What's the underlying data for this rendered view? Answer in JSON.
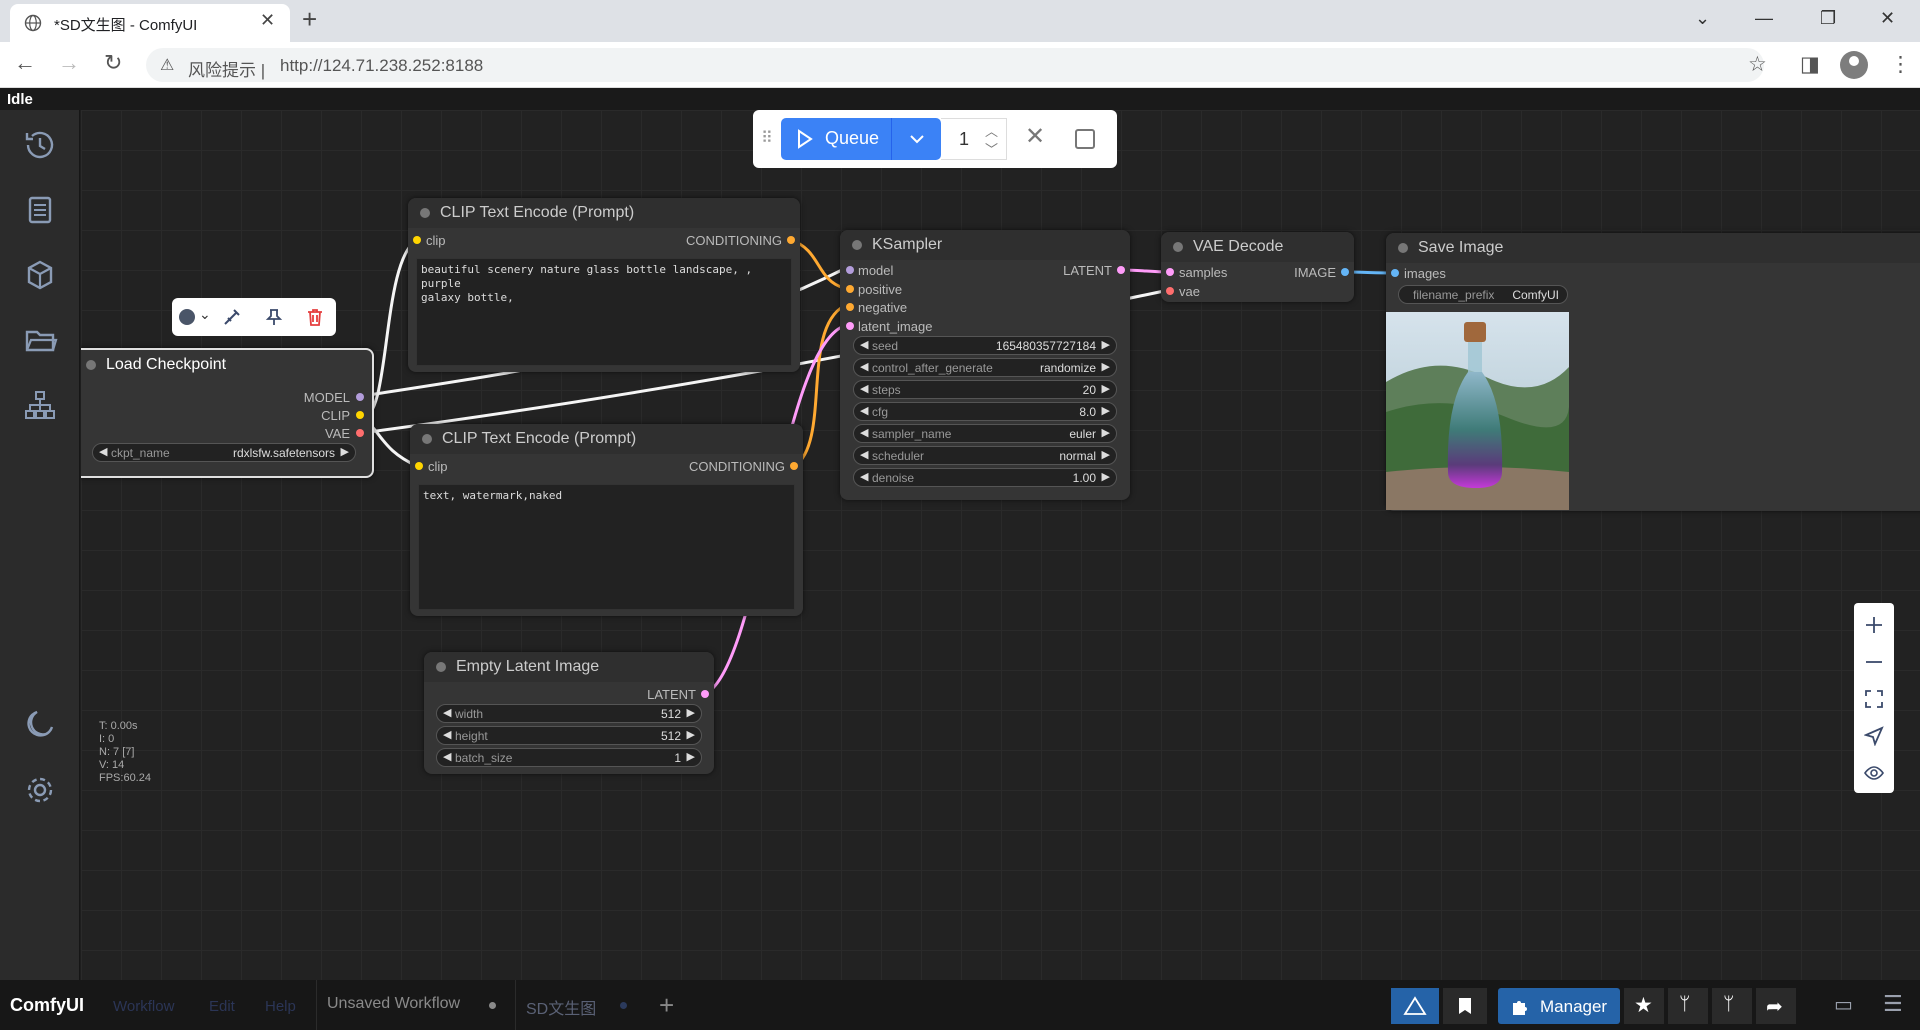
{
  "browser": {
    "tab_title": "*SD文生图 - ComfyUI",
    "address_warning": "风险提示 |",
    "url": "http://124.71.238.252:8188"
  },
  "app": {
    "status": "Idle",
    "brand": "ComfyUI",
    "menus": [
      "Workflow",
      "Edit",
      "Help"
    ],
    "workflow_tabs": [
      "Unsaved Workflow",
      "SD文生图"
    ],
    "manager_label": "Manager"
  },
  "queue": {
    "label": "Queue",
    "count": "1"
  },
  "nodes": {
    "load_checkpoint": {
      "title": "Load Checkpoint",
      "outputs": [
        "MODEL",
        "CLIP",
        "VAE"
      ],
      "widget_label": "ckpt_name",
      "widget_value": "rdxlsfw.safetensors"
    },
    "clip_pos": {
      "title": "CLIP Text Encode (Prompt)",
      "input": "clip",
      "output": "CONDITIONING",
      "text": "beautiful scenery nature glass bottle landscape, , purple\ngalaxy bottle,"
    },
    "clip_neg": {
      "title": "CLIP Text Encode (Prompt)",
      "input": "clip",
      "output": "CONDITIONING",
      "text": "text, watermark,naked"
    },
    "empty_latent": {
      "title": "Empty Latent Image",
      "output": "LATENT",
      "widgets": [
        {
          "label": "width",
          "value": "512"
        },
        {
          "label": "height",
          "value": "512"
        },
        {
          "label": "batch_size",
          "value": "1"
        }
      ]
    },
    "ksampler": {
      "title": "KSampler",
      "inputs": [
        "model",
        "positive",
        "negative",
        "latent_image"
      ],
      "output": "LATENT",
      "widgets": [
        {
          "label": "seed",
          "value": "165480357727184"
        },
        {
          "label": "control_after_generate",
          "value": "randomize"
        },
        {
          "label": "steps",
          "value": "20"
        },
        {
          "label": "cfg",
          "value": "8.0"
        },
        {
          "label": "sampler_name",
          "value": "euler"
        },
        {
          "label": "scheduler",
          "value": "normal"
        },
        {
          "label": "denoise",
          "value": "1.00"
        }
      ]
    },
    "vae_decode": {
      "title": "VAE Decode",
      "inputs": [
        "samples",
        "vae"
      ],
      "output": "IMAGE"
    },
    "save_image": {
      "title": "Save Image",
      "input": "images",
      "widget_label": "filename_prefix",
      "widget_value": "ComfyUI"
    }
  },
  "stats": {
    "t": "T: 0.00s",
    "i": "I: 0",
    "n": "N: 7 [7]",
    "v": "V: 14",
    "fps": "FPS:60.24"
  },
  "colors": {
    "model": "#b39ddb",
    "clip": "#ffd500",
    "vae": "#ff6e6e",
    "conditioning": "#ffa931",
    "latent": "#ff9cf9",
    "image": "#64b5f6",
    "accent": "#3b82f6"
  }
}
